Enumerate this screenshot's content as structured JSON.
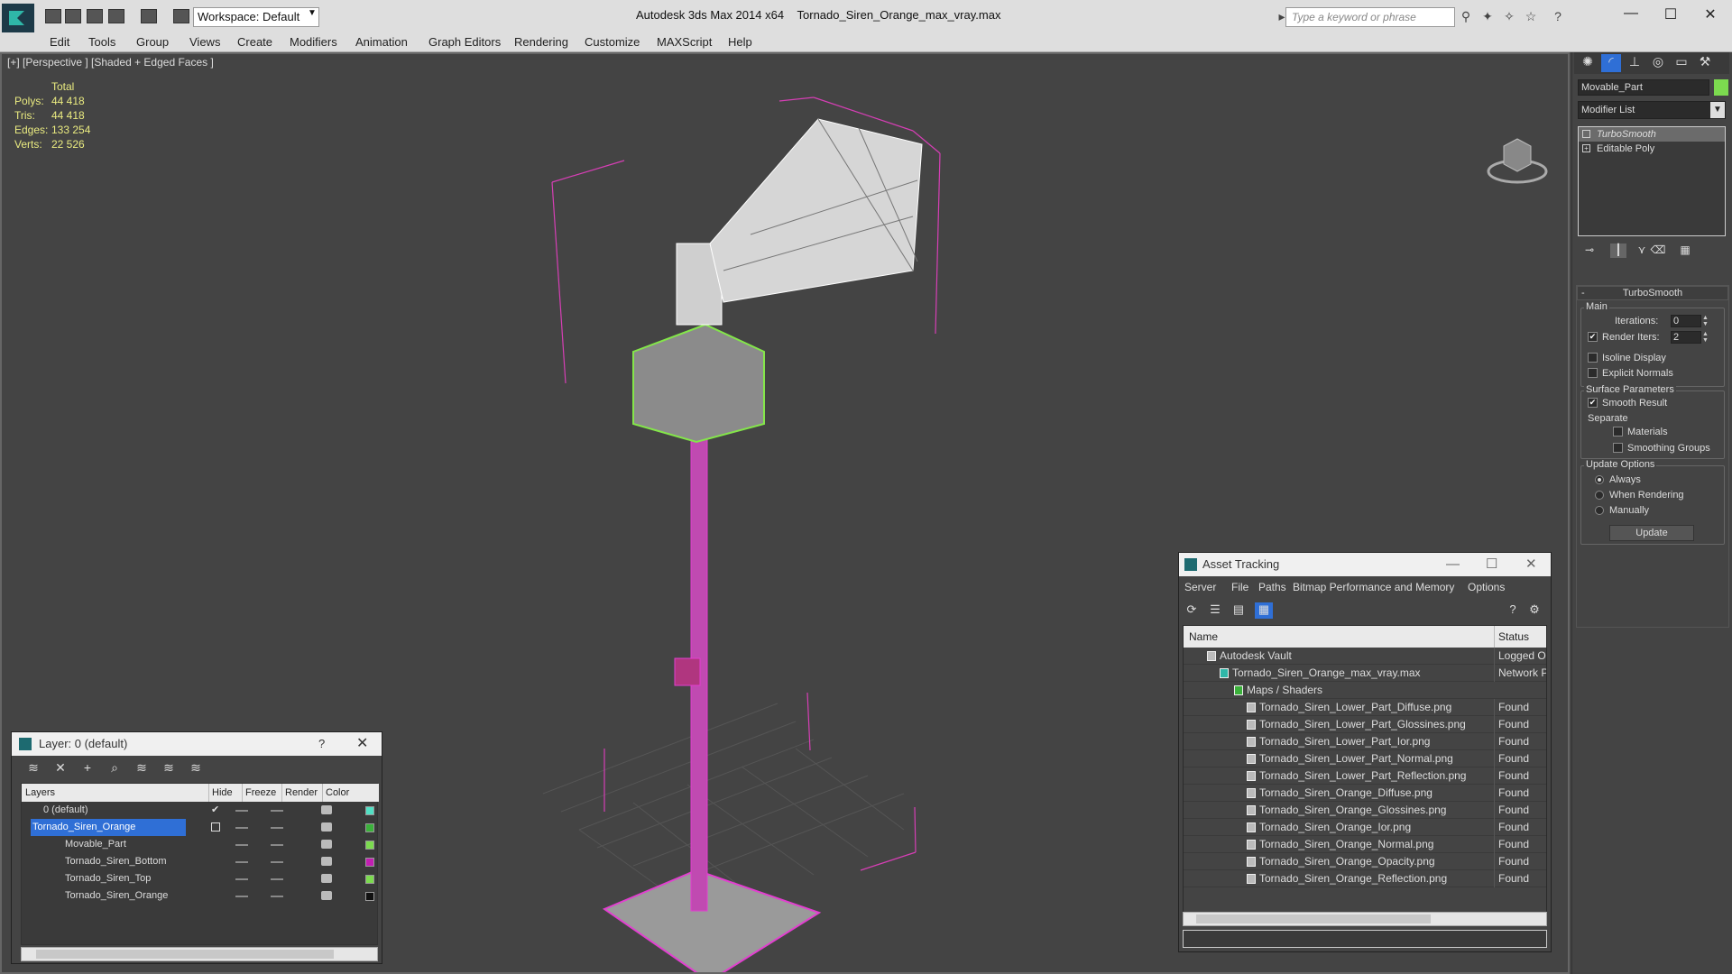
{
  "window": {
    "app_title": "Autodesk 3ds Max  2014 x64",
    "file_title": "Tornado_Siren_Orange_max_vray.max",
    "workspace": "Workspace: Default",
    "search_placeholder": "Type a keyword or phrase",
    "minimize": "—",
    "maximize": "☐",
    "close": "✕"
  },
  "menu": [
    "Edit",
    "Tools",
    "Group",
    "Views",
    "Create",
    "Modifiers",
    "Animation",
    "Graph Editors",
    "Rendering",
    "Customize",
    "MAXScript",
    "Help"
  ],
  "viewport": {
    "label": "[+] [Perspective ] [Shaded + Edged Faces ]",
    "stats": {
      "header": "Total",
      "polys_label": "Polys:",
      "polys": "44 418",
      "tris_label": "Tris:",
      "tris": "44 418",
      "edges_label": "Edges:",
      "edges": "133 254",
      "verts_label": "Verts:",
      "verts": "22 526"
    }
  },
  "command_panel": {
    "object_name": "Movable_Part",
    "object_color": "#7cdb4f",
    "modifier_list": "Modifier List",
    "stack": [
      "TurboSmooth",
      "Editable Poly"
    ],
    "rollout_title": "TurboSmooth",
    "main_label": "Main",
    "iterations_label": "Iterations:",
    "iterations": "0",
    "render_iters_label": "Render Iters:",
    "render_iters": "2",
    "isoline": "Isoline Display",
    "explicit_normals": "Explicit Normals",
    "surface_params": "Surface Parameters",
    "smooth_result": "Smooth Result",
    "separate": "Separate",
    "materials": "Materials",
    "smoothing_groups": "Smoothing Groups",
    "update_options": "Update Options",
    "always": "Always",
    "when_rendering": "When Rendering",
    "manually": "Manually",
    "update_button": "Update"
  },
  "layer_window": {
    "title": "Layer: 0 (default)",
    "help": "?",
    "close": "✕",
    "columns": [
      "Layers",
      "Hide",
      "Freeze",
      "Render",
      "Color"
    ],
    "rows": [
      {
        "name": "0 (default)",
        "color": "#52e0c4"
      },
      {
        "name": "Tornado_Siren_Orange",
        "color": "#3bb13b"
      },
      {
        "name": "Movable_Part",
        "color": "#7cdb4f"
      },
      {
        "name": "Tornado_Siren_Bottom",
        "color": "#c21fb2"
      },
      {
        "name": "Tornado_Siren_Top",
        "color": "#7cdb4f"
      },
      {
        "name": "Tornado_Siren_Orange",
        "color": "#111111"
      }
    ]
  },
  "asset_window": {
    "title": "Asset Tracking",
    "menu": [
      "Server",
      "File",
      "Paths",
      "Bitmap Performance and Memory",
      "Options"
    ],
    "col_name": "Name",
    "col_status": "Status",
    "rows": [
      {
        "name": "Autodesk Vault",
        "status": "Logged Ou"
      },
      {
        "name": "Tornado_Siren_Orange_max_vray.max",
        "status": "Network Pa"
      },
      {
        "name": "Maps / Shaders",
        "status": ""
      },
      {
        "name": "Tornado_Siren_Lower_Part_Diffuse.png",
        "status": "Found"
      },
      {
        "name": "Tornado_Siren_Lower_Part_Glossines.png",
        "status": "Found"
      },
      {
        "name": "Tornado_Siren_Lower_Part_Ior.png",
        "status": "Found"
      },
      {
        "name": "Tornado_Siren_Lower_Part_Normal.png",
        "status": "Found"
      },
      {
        "name": "Tornado_Siren_Lower_Part_Reflection.png",
        "status": "Found"
      },
      {
        "name": "Tornado_Siren_Orange_Diffuse.png",
        "status": "Found"
      },
      {
        "name": "Tornado_Siren_Orange_Glossines.png",
        "status": "Found"
      },
      {
        "name": "Tornado_Siren_Orange_Ior.png",
        "status": "Found"
      },
      {
        "name": "Tornado_Siren_Orange_Normal.png",
        "status": "Found"
      },
      {
        "name": "Tornado_Siren_Orange_Opacity.png",
        "status": "Found"
      },
      {
        "name": "Tornado_Siren_Orange_Reflection.png",
        "status": "Found"
      }
    ]
  }
}
